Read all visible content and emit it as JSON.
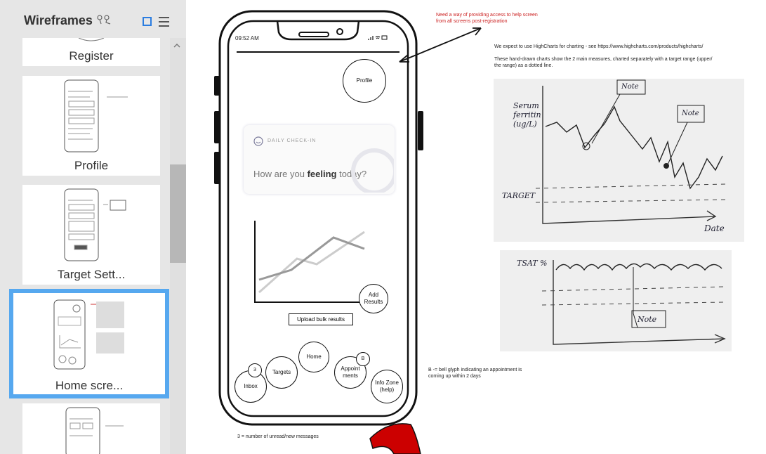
{
  "sidebar": {
    "title": "Wireframes",
    "pages": [
      {
        "label": "Register"
      },
      {
        "label": "Profile"
      },
      {
        "label": "Target Sett..."
      },
      {
        "label": "Home scre..."
      },
      {
        "label": ""
      }
    ]
  },
  "phone": {
    "time": "09:52 AM",
    "profile_label": "Profile",
    "checkin_label": "DAILY CHECK-IN",
    "feeling_prefix": "How are you ",
    "feeling_bold": "feeling",
    "feeling_suffix": " today?",
    "add_results_label": "Add Results",
    "upload_label": "Upload bulk results",
    "home_label": "Home",
    "targets_label": "Targets",
    "inbox_label": "Inbox",
    "inbox_badge": "3",
    "appointments_label": "Appoint ments",
    "appointments_badge": "B",
    "info_label": "Info Zone (help)"
  },
  "notes": {
    "red_note_line1": "Need a way of providing access to help screen",
    "red_note_line2": "from all screens post-registration",
    "highcharts_note": "We expect to use HighCharts for charting - see https://www.highcharts.com/products/highcharts/",
    "charts_note_line1": "These hand-drawn charts show the 2 main measures, charted separately with a target range (upper/",
    "charts_note_line2": "the range) as a dotted line.",
    "bell_note_line1": "B -= bell glyph indicating an appointment is",
    "bell_note_line2": "coming up within 2 days",
    "unread_note": "3 = number of unread/new messages"
  },
  "photo1": {
    "ylabel": "Serum ferritin (ug/L)",
    "note_a": "Note",
    "note_b": "Note",
    "target_label": "TARGET",
    "xlabel": "Date"
  },
  "photo2": {
    "ylabel": "TSAT %",
    "note": "Note"
  },
  "colors": {
    "accent": "#56a8ef",
    "red_note": "#cc2222",
    "pointer": "#cc0000"
  }
}
